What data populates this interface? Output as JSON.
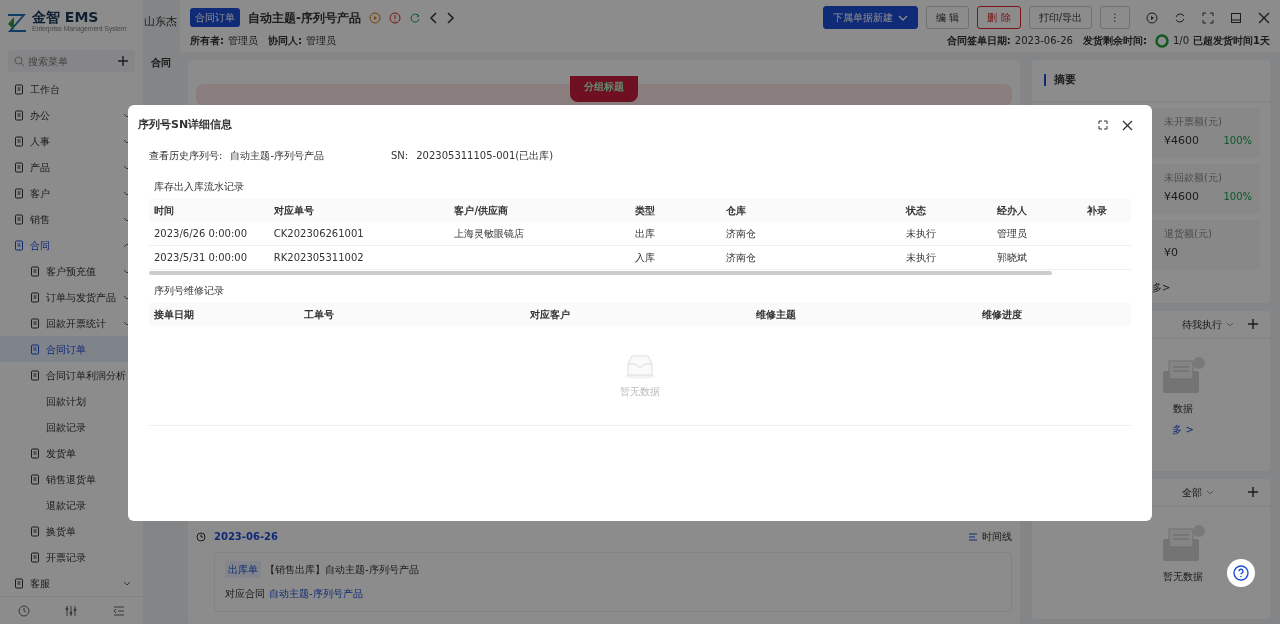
{
  "sidebar": {
    "brand": "金智 EMS",
    "subtitle": "Enterprise Management System",
    "search": {
      "placeholder": "搜索菜单"
    },
    "items": [
      {
        "label": "工作台",
        "kind": "link",
        "selected": false
      },
      {
        "label": "办公",
        "kind": "group",
        "expanded": false,
        "selected": false
      },
      {
        "label": "人事",
        "kind": "group",
        "expanded": false,
        "selected": false
      },
      {
        "label": "产品",
        "kind": "group",
        "expanded": false,
        "selected": false
      },
      {
        "label": "客户",
        "kind": "group",
        "expanded": false,
        "selected": false
      },
      {
        "label": "销售",
        "kind": "group",
        "expanded": false,
        "selected": false
      },
      {
        "label": "合同",
        "kind": "group",
        "expanded": true,
        "selected": true,
        "children": [
          {
            "label": "客户预充值",
            "kind": "group",
            "expanded": false,
            "selected": false
          },
          {
            "label": "订单与发货产品",
            "kind": "group",
            "expanded": false,
            "selected": false
          },
          {
            "label": "回款开票统计",
            "kind": "group",
            "expanded": false,
            "selected": false
          },
          {
            "label": "合同订单",
            "kind": "link",
            "selected": true
          },
          {
            "label": "合同订单利润分析",
            "kind": "link",
            "selected": false
          },
          {
            "label": "回款计划",
            "kind": "text",
            "selected": false
          },
          {
            "label": "回款记录",
            "kind": "text",
            "selected": false
          },
          {
            "label": "发货单",
            "kind": "link",
            "selected": false
          },
          {
            "label": "销售退货单",
            "kind": "link",
            "selected": false
          },
          {
            "label": "退款记录",
            "kind": "text",
            "selected": false
          },
          {
            "label": "换货单",
            "kind": "link",
            "selected": false
          },
          {
            "label": "开票记录",
            "kind": "link",
            "selected": false
          }
        ]
      },
      {
        "label": "客服",
        "kind": "group",
        "expanded": false,
        "selected": false
      }
    ]
  },
  "topbar": {
    "company": "山东杰",
    "tab": "合同"
  },
  "drawer": {
    "badge": "合同订单",
    "title": "自动主题-序列号产品",
    "owner_label": "所有者:",
    "owner": "管理员",
    "collab_label": "协同人:",
    "collab": "管理员",
    "buttons": [
      {
        "label": "下属单据新建",
        "kind": "primary"
      },
      {
        "label": "编 辑",
        "kind": "default"
      },
      {
        "label": "删 除",
        "kind": "danger"
      },
      {
        "label": "打印/导出",
        "kind": "default"
      },
      {
        "label": "⋮",
        "kind": "default"
      }
    ],
    "sign_date_label": "合同签单日期:",
    "sign_date": "2023-06-26",
    "remaining_label": "发货剩余时间:",
    "remaining_count": "1/0",
    "remaining_note": "已超发货时间1天",
    "group_title": "分组标题",
    "timeline": {
      "date": "2023-06-26",
      "toggle": "时间线",
      "tag": "出库单",
      "entry_title": "【销售出库】自动主题-序列号产品",
      "contract_label": "对应合同",
      "contract_link": "自动主题-序列号产品"
    }
  },
  "summary": {
    "title": "摘要",
    "stats": [
      {
        "label": "未开票额(元)",
        "value": "¥4600",
        "percent": "100%"
      },
      {
        "label": "未回款额(元)",
        "value": "¥4600",
        "percent": "100%"
      },
      {
        "label": "退货额(元)",
        "value": "¥0"
      }
    ],
    "more": "多>"
  },
  "tasks": {
    "filter": "待我执行",
    "empty": "数据",
    "more": "多 >"
  },
  "activities": {
    "filter": "全部",
    "empty": "暂无数据"
  },
  "modal": {
    "title": "序列号SN详细信息",
    "history_label": "查看历史序列号:",
    "history_value": "自动主题-序列号产品",
    "sn_label": "SN:",
    "sn_value": "202305311105-001(已出库)",
    "stock": {
      "title": "库存出入库流水记录",
      "columns": [
        "时间",
        "对应单号",
        "客户/供应商",
        "类型",
        "仓库",
        "状态",
        "经办人",
        "补录"
      ],
      "rows": [
        [
          "2023/6/26 0:00:00",
          "CK202306261001",
          "上海灵敏眼镜店",
          "出库",
          "济南仓",
          "未执行",
          "管理员"
        ],
        [
          "2023/5/31 0:00:00",
          "RK202305311002",
          "",
          "入库",
          "济南仓",
          "未执行",
          "郭晓斌"
        ]
      ]
    },
    "repair": {
      "title": "序列号维修记录",
      "columns": [
        "接单日期",
        "工单号",
        "对应客户",
        "维修主题",
        "维修进度"
      ],
      "empty": "暂无数据"
    }
  }
}
